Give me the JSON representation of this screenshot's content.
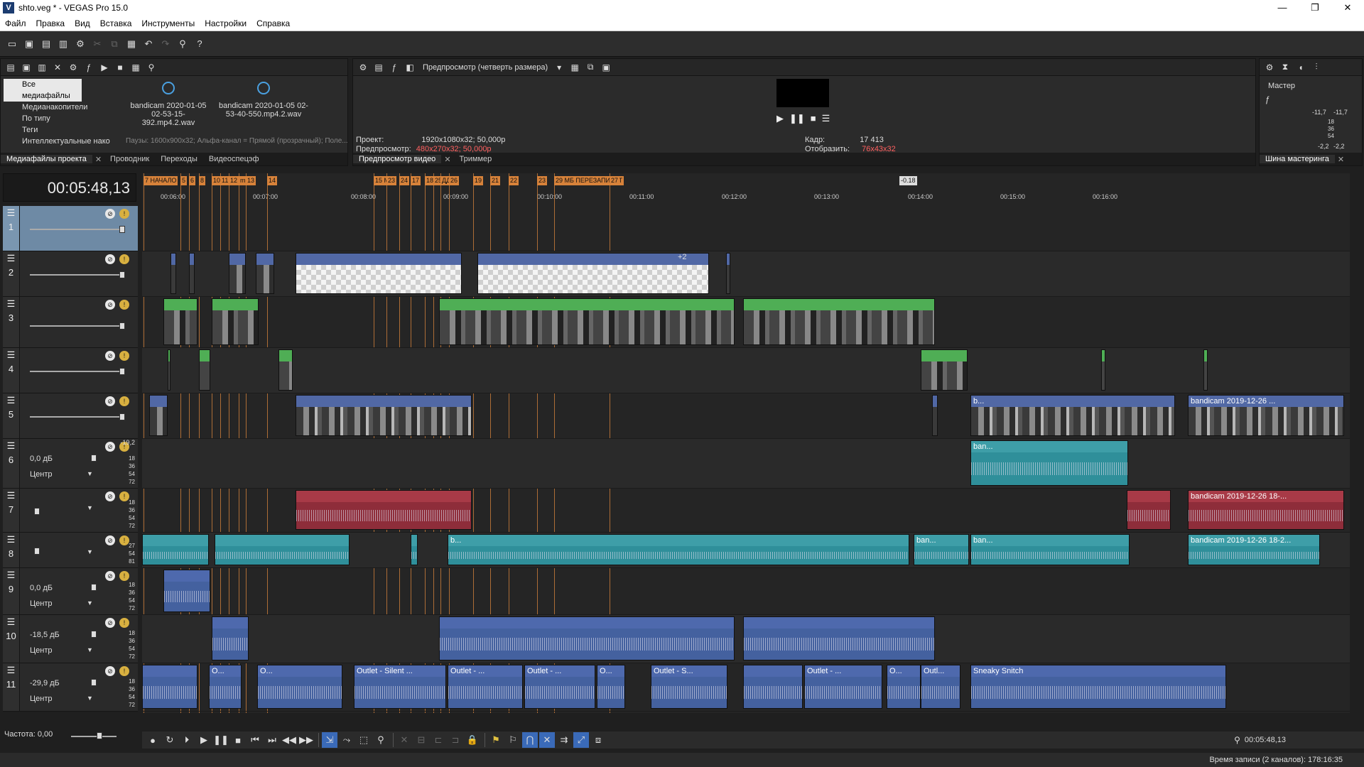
{
  "window": {
    "title": "shto.veg * - VEGAS Pro 15.0",
    "app_icon": "V",
    "buttons": [
      "—",
      "❐",
      "✕"
    ]
  },
  "menu": [
    "Файл",
    "Правка",
    "Вид",
    "Вставка",
    "Инструменты",
    "Настройки",
    "Справка"
  ],
  "media": {
    "tree": [
      "Все медиафайлы",
      "Медианакопители",
      "По типу",
      "Теги",
      "Интеллектуальные нако"
    ],
    "files": [
      {
        "name": "bandicam 2020-01-05 02-53-15-392.mp4.2.wav"
      },
      {
        "name": "bandicam 2020-01-05 02-53-40-550.mp4.2.wav"
      }
    ],
    "status": "Паузы: 1600x900x32; Альфа-канал = Прямой (прозрачный); Поле...",
    "tabs": [
      "Медиафайлы проекта",
      "Проводник",
      "Переходы",
      "Видеоспецэф"
    ]
  },
  "preview": {
    "quality": "Предпросмотр (четверть размера)",
    "project_label": "Проект:",
    "project_value": "1920x1080x32; 50,000p",
    "preview_label": "Предпросмотр:",
    "preview_value": "480x270x32; 50,000p",
    "frame_label": "Кадр:",
    "frame_value": "17 413",
    "display_label": "Отобразить:",
    "display_value": "76x43x32",
    "tabs": [
      "Предпросмотр видео",
      "Триммер"
    ]
  },
  "master": {
    "label": "Мастер",
    "left": "-11,7",
    "right": "-11,7",
    "scale": [
      "18",
      "36",
      "54"
    ],
    "bottom_left": "-2,2",
    "bottom_right": "-2,2",
    "tab": "Шина мастеринга"
  },
  "timeline": {
    "timecode": "00:05:48,13",
    "ruler": [
      "00:06:00",
      "00:07:00",
      "00:08:00",
      "00:09:00",
      "00:10:00",
      "00:11:00",
      "00:12:00",
      "00:13:00",
      "00:14:00",
      "00:15:00",
      "00:16:00"
    ],
    "markers": [
      "7 НАЧАЛО",
      "5",
      "6",
      "8",
      "10",
      "11",
      "12",
      "m",
      "13",
      "14",
      "15 МБ",
      "23",
      "24",
      "17",
      "18",
      "25",
      "ДД",
      "26",
      "19",
      "21",
      "22",
      "23",
      "29 МБ ПЕРЕЗАПИСАТ",
      "27"
    ],
    "region_tag": "-0.18",
    "tracks": [
      {
        "num": "1"
      },
      {
        "num": "2"
      },
      {
        "num": "3"
      },
      {
        "num": "4"
      },
      {
        "num": "5"
      },
      {
        "num": "6",
        "vol": "0,0 дБ",
        "pan": "Центр",
        "peak": "-19,2"
      },
      {
        "num": "7"
      },
      {
        "num": "8"
      },
      {
        "num": "9",
        "vol": "0,0 дБ",
        "pan": "Центр"
      },
      {
        "num": "10",
        "vol": "-18,5 дБ",
        "pan": "Центр"
      },
      {
        "num": "11",
        "vol": "-29,9 дБ",
        "pan": "Центр"
      }
    ],
    "meter_scale": [
      "18",
      "36",
      "54",
      "72"
    ],
    "meter_scale_b": [
      "27",
      "54",
      "81"
    ],
    "clip_labels": {
      "c5a": "b...",
      "c5b": "bandicam 2019-12-26 ...",
      "c6a": "ban...",
      "c7a": "bandicam 2019-12-26 18-...",
      "c8a": "b...",
      "c8b": "ban...",
      "c8c": "ban...",
      "c8d": "bandicam 2019-12-26 18-2...",
      "c11a": "O...",
      "c11b": "Outlet - Silent ...",
      "c11c": "Outlet - ...",
      "c11d": "Outlet - ...",
      "c11e": "O...",
      "c11f": "Outlet - S...",
      "c11g": "Outlet - ...",
      "c11h": "O...",
      "c11i": "Outl...",
      "c11j": "Sneaky Snitch",
      "c11k": "O..."
    },
    "fx_count": "+2"
  },
  "bottom": {
    "rate_label": "Частота: 0,00",
    "cursor_time": "00:05:48,13"
  },
  "status": {
    "text": "Время записи (2 каналов): 178:16:35"
  },
  "colors": {
    "video": "#5168a5",
    "green": "#4fae55",
    "teal": "#3e9ea8",
    "red": "#a83a47",
    "marker": "#d7823a"
  }
}
